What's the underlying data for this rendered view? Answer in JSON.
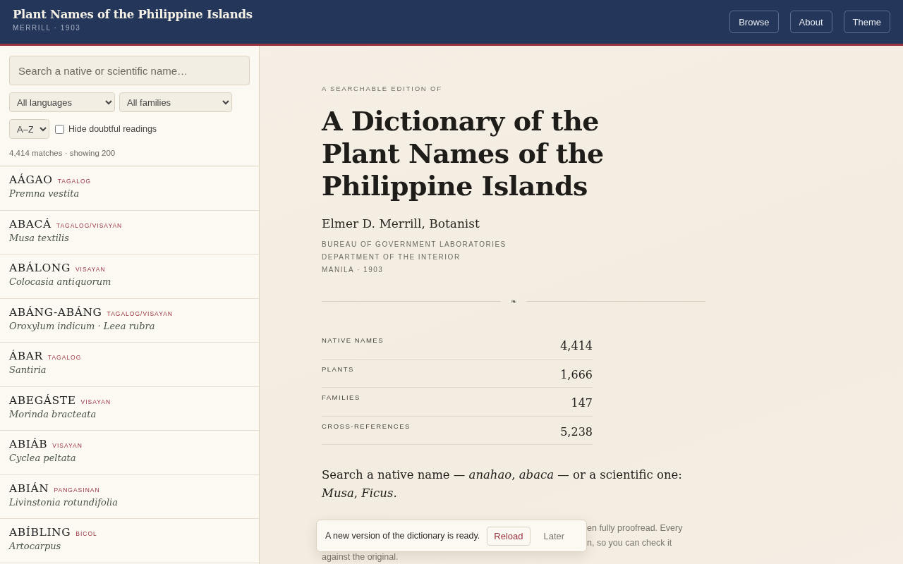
{
  "header": {
    "title": "Plant Names of the Philippine Islands",
    "subtitle": "MERRILL · 1903",
    "buttons": [
      "Browse",
      "About",
      "Theme"
    ]
  },
  "sidebar": {
    "search": {
      "placeholder": "Search a native or scientific name…"
    },
    "filters": {
      "language": "All languages",
      "family": "All families",
      "sort": "A–Z"
    },
    "hide_doubtful": {
      "label": "Hide doubtful readings",
      "checked": false
    },
    "count": "4,414 matches · showing 200",
    "entries": [
      {
        "name": "AÁGAO",
        "language": "TAGALOG",
        "scientific": "Premna vestita"
      },
      {
        "name": "ABACÁ",
        "language": "TAGALOG/VISAYAN",
        "scientific": "Musa textilis"
      },
      {
        "name": "ABÁLONG",
        "language": "VISAYAN",
        "scientific": "Colocasia antiquorum"
      },
      {
        "name": "ABÁNG-ABÁNG",
        "language": "TAGALOG/VISAYAN",
        "scientific": "Oroxylum indicum · Leea rubra"
      },
      {
        "name": "ÁBAR",
        "language": "TAGALOG",
        "scientific": "Santiria"
      },
      {
        "name": "ABEGÁSTE",
        "language": "VISAYAN",
        "scientific": "Morinda bracteata"
      },
      {
        "name": "ABIÁB",
        "language": "VISAYAN",
        "scientific": "Cyclea peltata"
      },
      {
        "name": "ABIÁN",
        "language": "PANGASINAN",
        "scientific": "Livinstonia rotundifolia"
      },
      {
        "name": "ABÍBLING",
        "language": "BICOL",
        "scientific": "Artocarpus"
      }
    ]
  },
  "main": {
    "eyebrow": "A SEARCHABLE EDITION OF",
    "title": [
      "A Dictionary of the",
      "Plant Names of the",
      "Philippine Islands"
    ],
    "author": "Elmer D. Merrill, Botanist",
    "imprint": [
      "BUREAU OF GOVERNMENT LABORATORIES",
      "DEPARTMENT OF THE INTERIOR",
      "MANILA · 1903"
    ],
    "ornament": "❧",
    "stats": [
      {
        "label": "NATIVE NAMES",
        "value": "4,414"
      },
      {
        "label": "PLANTS",
        "value": "1,666"
      },
      {
        "label": "FAMILIES",
        "value": "147"
      },
      {
        "label": "CROSS-REFERENCES",
        "value": "5,238"
      }
    ],
    "intro": "Search a native name — *anahao*, *abaca* — or a scientific one: *Musa*, *Ficus*.",
    "note_lines": [
      "en fully proofread. Every",
      "n, so you can check it",
      "against the original."
    ]
  },
  "toast": {
    "message": "A new version of the dictionary is ready.",
    "reload": "Reload",
    "later": "Later"
  }
}
